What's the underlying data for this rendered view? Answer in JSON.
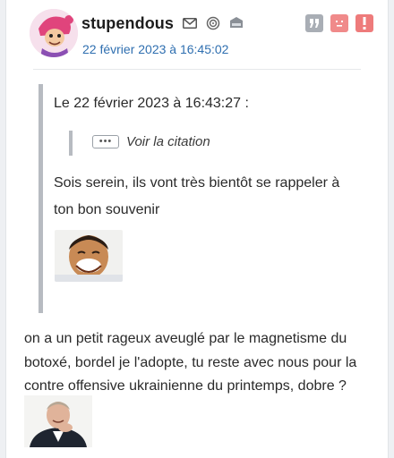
{
  "post": {
    "author": "stupendous",
    "date": "22 février 2023 à 16:45:02",
    "quote": {
      "header": "Le 22 février 2023 à 16:43:27 :",
      "nested_toggle": "•••",
      "nested_label": "Voir la citation",
      "text": "Sois serein, ils vont très bientôt se rappeler à ton bon souvenir"
    },
    "reply_text": "on a un petit rageux aveuglé par le magnetisme du botoxé, bordel je l'adopte, tu reste avec nous pour la contre offensive ukrainienne du printemps, dobre ?"
  },
  "header_icons": [
    "mail-icon",
    "spiral-icon",
    "badge-icon"
  ],
  "actions": [
    {
      "name": "quote-button",
      "glyph": "❞"
    },
    {
      "name": "private-message-button",
      "glyph": "☹"
    },
    {
      "name": "report-button",
      "glyph": "!"
    }
  ],
  "colors": {
    "link": "#2f6fb0",
    "quote_bar": "#b7bbc1",
    "alert": "#ee7b7b"
  }
}
